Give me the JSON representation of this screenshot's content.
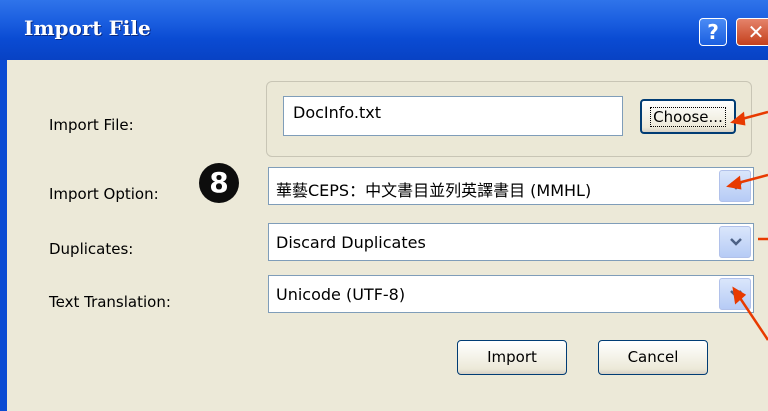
{
  "window": {
    "title": "Import File",
    "help_glyph": "?",
    "close_glyph": "✕"
  },
  "form": {
    "import_file": {
      "label": "Import File:",
      "value": "DocInfo.txt",
      "choose_label": "Choose..."
    },
    "import_option": {
      "label": "Import Option:",
      "value": "華藝CEPS：中文書目並列英譯書目 (MMHL)"
    },
    "duplicates": {
      "label": "Duplicates:",
      "value": "Discard Duplicates"
    },
    "text_translation": {
      "label": "Text Translation:",
      "value": "Unicode (UTF-8)"
    }
  },
  "badge": {
    "text": "8"
  },
  "buttons": {
    "import": "Import",
    "cancel": "Cancel"
  },
  "colors": {
    "titlebar": "#0a4bd3",
    "dialog_bg": "#ece9d8",
    "annotation_arrow": "#e83a00",
    "badge_bg": "#0d0d0d"
  }
}
